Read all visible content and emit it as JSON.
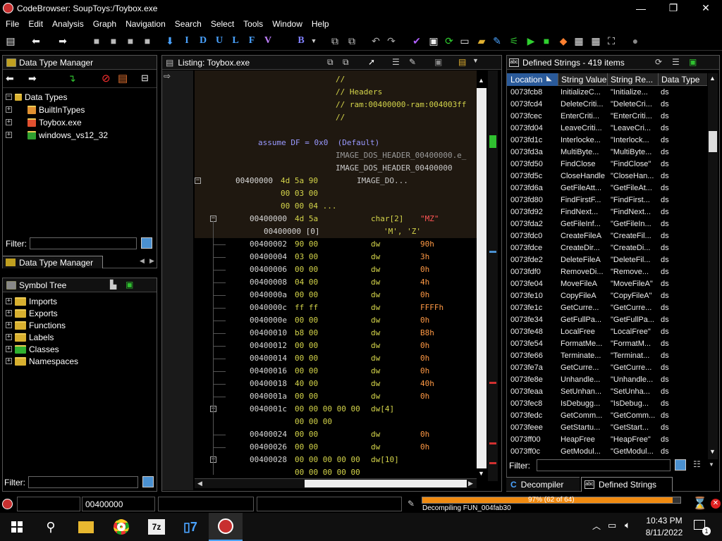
{
  "window": {
    "title": "CodeBrowser: SoupToys:/Toybox.exe",
    "minimize": "—",
    "maximize": "❐",
    "close": "✕"
  },
  "menu": [
    "File",
    "Edit",
    "Analysis",
    "Graph",
    "Navigation",
    "Search",
    "Select",
    "Tools",
    "Window",
    "Help"
  ],
  "toolbar": {
    "letters": [
      "I",
      "D",
      "U",
      "L",
      "F",
      "V",
      "B"
    ]
  },
  "data_type_manager": {
    "title": "Data Type Manager",
    "root": "Data Types",
    "items": [
      "BuiltInTypes",
      "Toybox.exe",
      "windows_vs12_32"
    ],
    "filter_label": "Filter:",
    "tab_label": "Data Type Manager"
  },
  "symbol_tree": {
    "title": "Symbol Tree",
    "items": [
      "Imports",
      "Exports",
      "Functions",
      "Labels",
      "Classes",
      "Namespaces"
    ],
    "filter_label": "Filter:"
  },
  "listing": {
    "title": "Listing:  Toybox.exe",
    "comments": [
      "//",
      "// Headers",
      "// ram:00400000-ram:004003ff",
      "//"
    ],
    "assume": "assume DF = 0x0  (Default)",
    "label1": "IMAGE_DOS_HEADER_00400000.e_",
    "label2": "IMAGE_DOS_HEADER_00400000",
    "main_addr": "00400000",
    "main_bytes": "4d 5a 90",
    "main_label": "IMAGE_DO...",
    "more_bytes1": "00 03 00",
    "more_bytes2": "00 00 04 ...",
    "char_addr": "00400000",
    "char_bytes": "4d 5a",
    "char_mn": "char[2]",
    "char_op": "\"MZ\"",
    "char_sub_addr": "00400000 [0]",
    "char_sub_val": "'M', 'Z'",
    "rows": [
      {
        "addr": "00400002",
        "bytes": "90 00",
        "mn": "dw",
        "op": "90h"
      },
      {
        "addr": "00400004",
        "bytes": "03 00",
        "mn": "dw",
        "op": "3h"
      },
      {
        "addr": "00400006",
        "bytes": "00 00",
        "mn": "dw",
        "op": "0h"
      },
      {
        "addr": "00400008",
        "bytes": "04 00",
        "mn": "dw",
        "op": "4h"
      },
      {
        "addr": "0040000a",
        "bytes": "00 00",
        "mn": "dw",
        "op": "0h"
      },
      {
        "addr": "0040000c",
        "bytes": "ff ff",
        "mn": "dw",
        "op": "FFFFh"
      },
      {
        "addr": "0040000e",
        "bytes": "00 00",
        "mn": "dw",
        "op": "0h"
      },
      {
        "addr": "00400010",
        "bytes": "b8 00",
        "mn": "dw",
        "op": "B8h"
      },
      {
        "addr": "00400012",
        "bytes": "00 00",
        "mn": "dw",
        "op": "0h"
      },
      {
        "addr": "00400014",
        "bytes": "00 00",
        "mn": "dw",
        "op": "0h"
      },
      {
        "addr": "00400016",
        "bytes": "00 00",
        "mn": "dw",
        "op": "0h"
      },
      {
        "addr": "00400018",
        "bytes": "40 00",
        "mn": "dw",
        "op": "40h"
      },
      {
        "addr": "0040001a",
        "bytes": "00 00",
        "mn": "dw",
        "op": "0h"
      }
    ],
    "arr1_addr": "0040001c",
    "arr1_bytes": "00 00 00 00 00",
    "arr1_mn": "dw[4]",
    "arr1_more": "00 00 00",
    "rows2": [
      {
        "addr": "00400024",
        "bytes": "00 00",
        "mn": "dw",
        "op": "0h"
      },
      {
        "addr": "00400026",
        "bytes": "00 00",
        "mn": "dw",
        "op": "0h"
      }
    ],
    "arr2_addr": "00400028",
    "arr2_bytes": "00 00 00 00 00",
    "arr2_mn": "dw[10]",
    "arr2_more": "00 00 00 00 00"
  },
  "defined_strings": {
    "title": "Defined Strings - 419 items",
    "columns": [
      "Location",
      "String Value",
      "String Re...",
      "Data Type"
    ],
    "rows": [
      [
        "0073fcb8",
        "InitializeC...",
        "\"Initialize...",
        "ds"
      ],
      [
        "0073fcd4",
        "DeleteCriti...",
        "\"DeleteCri...",
        "ds"
      ],
      [
        "0073fcec",
        "EnterCriti...",
        "\"EnterCriti...",
        "ds"
      ],
      [
        "0073fd04",
        "LeaveCriti...",
        "\"LeaveCri...",
        "ds"
      ],
      [
        "0073fd1c",
        "Interlocke...",
        "\"Interlock...",
        "ds"
      ],
      [
        "0073fd3a",
        "MultiByte...",
        "\"MultiByte...",
        "ds"
      ],
      [
        "0073fd50",
        "FindClose",
        "\"FindClose\"",
        "ds"
      ],
      [
        "0073fd5c",
        "CloseHandle",
        "\"CloseHan...",
        "ds"
      ],
      [
        "0073fd6a",
        "GetFileAtt...",
        "\"GetFileAt...",
        "ds"
      ],
      [
        "0073fd80",
        "FindFirstF...",
        "\"FindFirst...",
        "ds"
      ],
      [
        "0073fd92",
        "FindNext...",
        "\"FindNext...",
        "ds"
      ],
      [
        "0073fda2",
        "GetFileInf...",
        "\"GetFileIn...",
        "ds"
      ],
      [
        "0073fdc0",
        "CreateFileA",
        "\"CreateFil...",
        "ds"
      ],
      [
        "0073fdce",
        "CreateDir...",
        "\"CreateDi...",
        "ds"
      ],
      [
        "0073fde2",
        "DeleteFileA",
        "\"DeleteFil...",
        "ds"
      ],
      [
        "0073fdf0",
        "RemoveDi...",
        "\"Remove...",
        "ds"
      ],
      [
        "0073fe04",
        "MoveFileA",
        "\"MoveFileA\"",
        "ds"
      ],
      [
        "0073fe10",
        "CopyFileA",
        "\"CopyFileA\"",
        "ds"
      ],
      [
        "0073fe1c",
        "GetCurre...",
        "\"GetCurre...",
        "ds"
      ],
      [
        "0073fe34",
        "GetFullPa...",
        "\"GetFullPa...",
        "ds"
      ],
      [
        "0073fe48",
        "LocalFree",
        "\"LocalFree\"",
        "ds"
      ],
      [
        "0073fe54",
        "FormatMe...",
        "\"FormatM...",
        "ds"
      ],
      [
        "0073fe66",
        "Terminate...",
        "\"Terminat...",
        "ds"
      ],
      [
        "0073fe7a",
        "GetCurre...",
        "\"GetCurre...",
        "ds"
      ],
      [
        "0073fe8e",
        "Unhandle...",
        "\"Unhandle...",
        "ds"
      ],
      [
        "0073feaa",
        "SetUnhan...",
        "\"SetUnha...",
        "ds"
      ],
      [
        "0073fec8",
        "IsDebugg...",
        "\"IsDebug...",
        "ds"
      ],
      [
        "0073fedc",
        "GetComm...",
        "\"GetComm...",
        "ds"
      ],
      [
        "0073feee",
        "GetStartu...",
        "\"GetStart...",
        "ds"
      ],
      [
        "0073ff00",
        "HeapFree",
        "\"HeapFree\"",
        "ds"
      ],
      [
        "0073ff0c",
        "GetModul...",
        "\"GetModul...",
        "ds"
      ]
    ],
    "filter_label": "Filter:"
  },
  "bottom_tabs": [
    "Decompiler",
    "Defined Strings"
  ],
  "status": {
    "address": "00400000",
    "progress_text": "97% (62 of 64)",
    "progress_fraction": 0.97,
    "task": "Decompiling FUN_004fab30"
  },
  "taskbar": {
    "time": "10:43 PM",
    "date": "8/11/2022",
    "badge": "1"
  }
}
